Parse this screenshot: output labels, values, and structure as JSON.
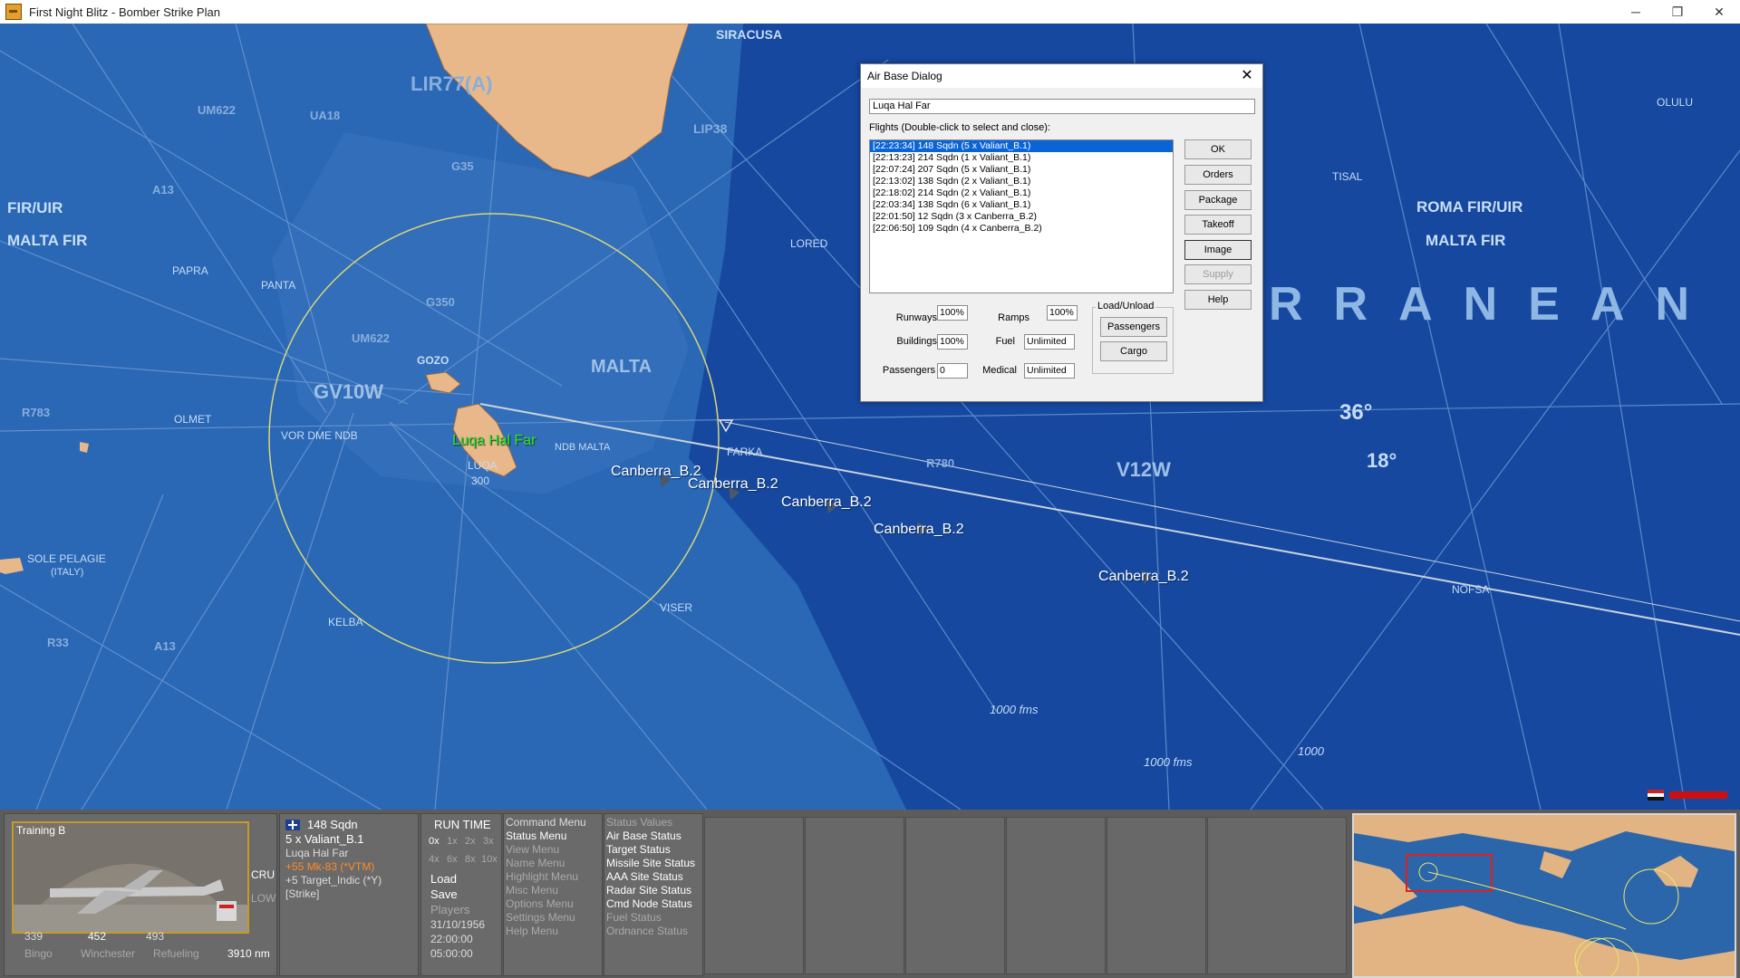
{
  "window": {
    "title": "First Night Blitz - Bomber Strike Plan",
    "controls": [
      "─",
      "❐",
      "✕"
    ]
  },
  "map": {
    "fir_labels": [
      "FIR/UIR",
      "MALTA FIR",
      "ROMA FIR/UIR",
      "MALTA FIR"
    ],
    "sea_text": "RRANEAN",
    "places": {
      "siracusa": "SIRACUSA",
      "malta": "MALTA",
      "gozo": "GOZO",
      "luqa": "LUQA",
      "luqa_alt": "300",
      "papra": "PAPRA",
      "panta": "PANTA",
      "olmet": "OLMET",
      "lored": "LORED",
      "tisal": "TISAL",
      "olulu": "OLULU",
      "farka": "FARKA",
      "viser": "VISER",
      "kelba": "KELBA",
      "nofsa": "NOFSA",
      "sole_pelagie": "SOLE PELAGIE",
      "italy": "(ITALY)",
      "vor_dme": "VOR DME NDB",
      "ndb_malta": "NDB MALTA",
      "lip38": "LIP38",
      "lir77a": "LIR77(A)",
      "fathoms1": "1000 fms",
      "fathoms2": "1000 fms",
      "fathoms3": "1000",
      "lat36": "36°",
      "lon18": "18°"
    },
    "airways": [
      "UM622",
      "UA18",
      "A13",
      "G35",
      "G350",
      "UM622",
      "R783",
      "R780",
      "A13",
      "R33",
      "GV10W",
      "V12W",
      "UA18"
    ],
    "aircraft_labels": [
      "Canberra_B.2",
      "Canberra_B.2",
      "Canberra_B.2",
      "Canberra_B.2",
      "Canberra_B.2"
    ],
    "base_label": "Luqa Hal Far"
  },
  "dialog": {
    "title": "Air Base Dialog",
    "base_name": "Luqa Hal Far",
    "flights_label": "Flights (Double-click to select and close):",
    "flights": [
      "[22:23:34] 148 Sqdn (5 x Valiant_B.1)",
      "[22:13:23] 214 Sqdn (1 x Valiant_B.1)",
      "[22:07:24] 207 Sqdn (5 x Valiant_B.1)",
      "[22:13:02] 138 Sqdn (2 x Valiant_B.1)",
      "[22:18:02] 214 Sqdn (2 x Valiant_B.1)",
      "[22:03:34] 138 Sqdn (6 x Valiant_B.1)",
      "[22:01:50] 12 Sqdn (3 x Canberra_B.2)",
      "[22:06:50] 109 Sqdn (4 x Canberra_B.2)"
    ],
    "buttons": {
      "ok": "OK",
      "orders": "Orders",
      "package": "Package",
      "takeoff": "Takeoff",
      "image": "Image",
      "supply": "Supply",
      "help": "Help"
    },
    "stats": {
      "runways_label": "Runways",
      "runways": "100%",
      "ramps_label": "Ramps",
      "ramps": "100%",
      "buildings_label": "Buildings",
      "buildings": "100%",
      "fuel_label": "Fuel",
      "fuel": "Unlimited",
      "passengers_label": "Passengers",
      "passengers": "0",
      "medical_label": "Medical",
      "medical": "Unlimited"
    },
    "load_unload": {
      "title": "Load/Unload",
      "passengers": "Passengers",
      "cargo": "Cargo"
    }
  },
  "bottom": {
    "thumb_label": "Training B",
    "alt_values": [
      "339",
      "452",
      "493"
    ],
    "alt_labels": [
      "Bingo",
      "Winchester",
      "Refueling"
    ],
    "range": "3910 nm",
    "speed_mode": "CRU",
    "alt_mode": "LOW",
    "unit": {
      "squadron": "148 Sqdn",
      "aircraft": "5 x Valiant_B.1",
      "base": "Luqa Hal Far",
      "weapon": "+55 Mk-83 (*VTM)",
      "target": "+5 Target_Indic (*Y)",
      "mission": "[Strike]"
    },
    "runtime": {
      "title": "RUN TIME",
      "speeds_row1": [
        "0x",
        "1x",
        "2x",
        "3x"
      ],
      "speeds_row2": [
        "4x",
        "6x",
        "8x",
        "10x"
      ],
      "load": "Load",
      "save": "Save",
      "players": "Players",
      "date": "31/10/1956",
      "time": "22:00:00",
      "duration": "05:00:00"
    },
    "menus": [
      "Command Menu",
      "Status Menu",
      "View Menu",
      "Name Menu",
      "Highlight Menu",
      "Misc Menu",
      "Options Menu",
      "Settings Menu",
      "Help Menu"
    ],
    "status": [
      "Status Values",
      "Air Base Status",
      "Target Status",
      "Missile Site Status",
      "AAA Site Status",
      "Radar Site Status",
      "Cmd Node Status",
      "Fuel Status",
      "Ordnance Status"
    ]
  }
}
